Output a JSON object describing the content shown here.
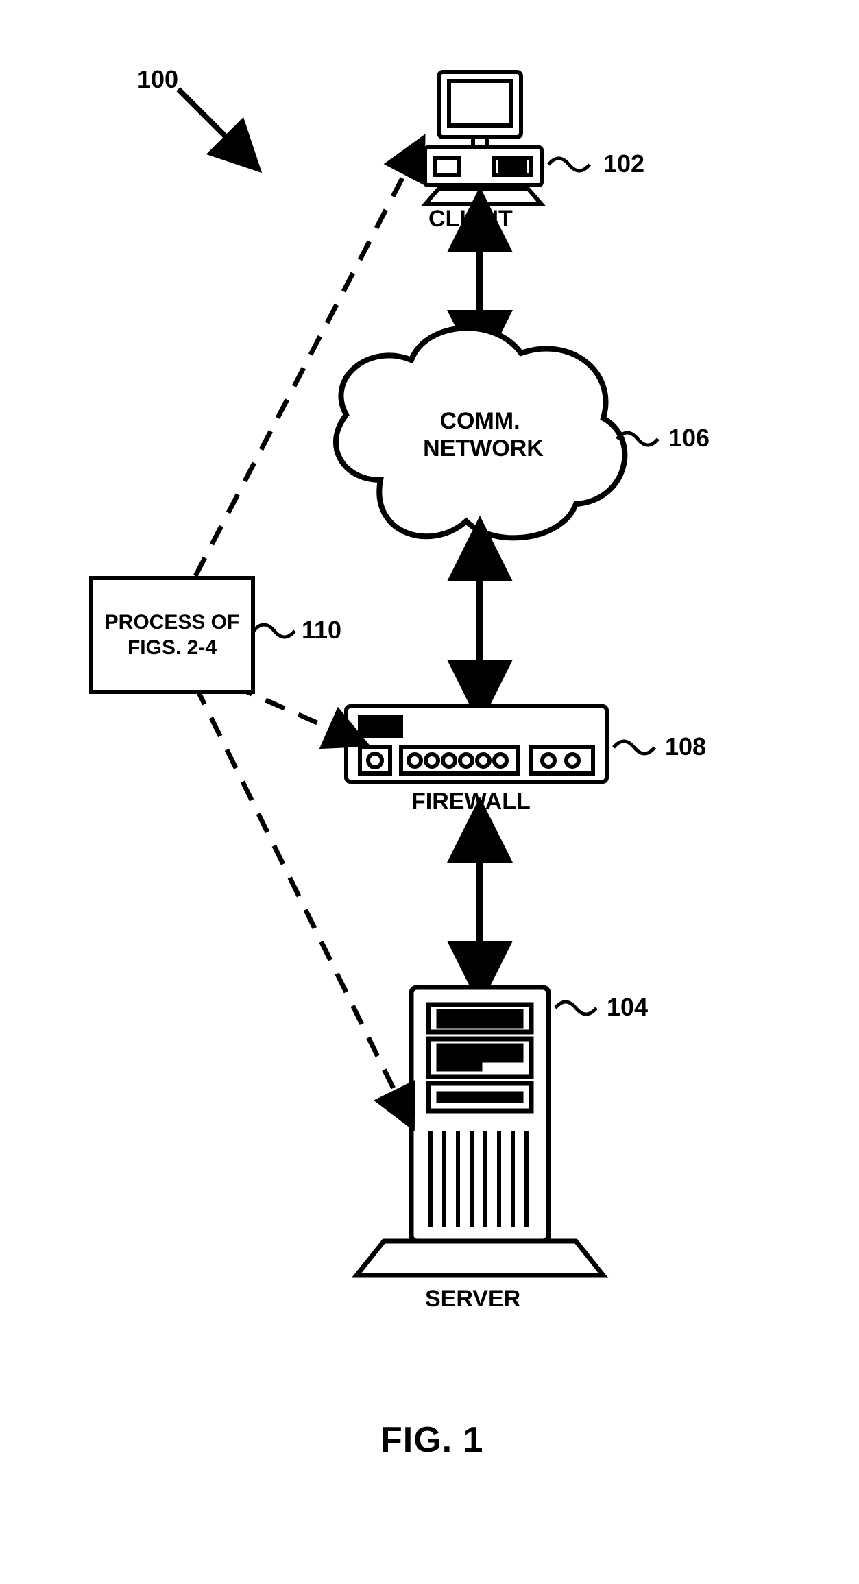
{
  "figure_label": "FIG. 1",
  "refs": {
    "r100": "100",
    "r102": "102",
    "r104": "104",
    "r106": "106",
    "r108": "108",
    "r110": "110"
  },
  "labels": {
    "client": "CLIENT",
    "network_line1": "COMM.",
    "network_line2": "NETWORK",
    "firewall": "FIREWALL",
    "server": "SERVER",
    "process_line1": "PROCESS OF",
    "process_line2": "FIGS. 2-4"
  }
}
